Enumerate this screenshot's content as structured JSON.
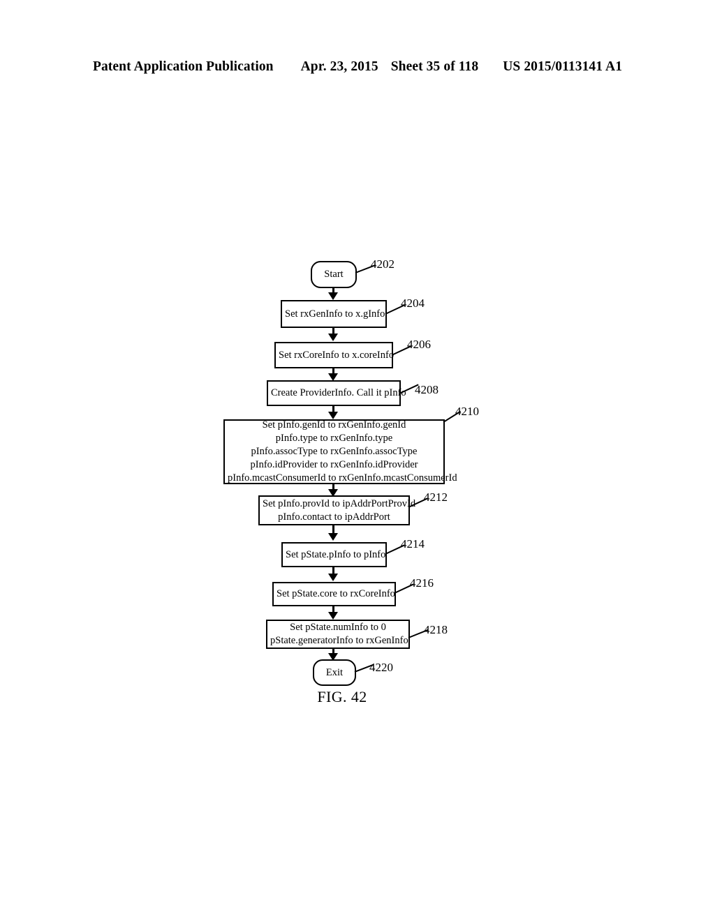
{
  "header": {
    "publication": "Patent Application Publication",
    "date": "Apr. 23, 2015",
    "sheet": "Sheet 35 of 118",
    "patent_number": "US 2015/0113141 A1"
  },
  "figure": {
    "caption": "FIG. 42",
    "nodes": [
      {
        "ref": "4202",
        "shape": "terminator",
        "lines": [
          "Start"
        ]
      },
      {
        "ref": "4204",
        "shape": "process",
        "lines": [
          "Set rxGenInfo to x.gInfo"
        ]
      },
      {
        "ref": "4206",
        "shape": "process",
        "lines": [
          "Set rxCoreInfo to x.coreInfo"
        ]
      },
      {
        "ref": "4208",
        "shape": "process",
        "lines": [
          "Create ProviderInfo. Call it pInfo"
        ]
      },
      {
        "ref": "4210",
        "shape": "process",
        "lines": [
          "Set pInfo.genId to rxGenInfo.genId",
          "pInfo.type to rxGenInfo.type",
          "pInfo.assocType to rxGenInfo.assocType",
          "pInfo.idProvider to rxGenInfo.idProvider",
          "pInfo.mcastConsumerId to rxGenInfo.mcastConsumerId"
        ]
      },
      {
        "ref": "4212",
        "shape": "process",
        "lines": [
          "Set pInfo.provId to ipAddrPortProvId",
          "pInfo.contact to ipAddrPort"
        ]
      },
      {
        "ref": "4214",
        "shape": "process",
        "lines": [
          "Set pState.pInfo to pInfo"
        ]
      },
      {
        "ref": "4216",
        "shape": "process",
        "lines": [
          "Set pState.core to rxCoreInfo"
        ]
      },
      {
        "ref": "4218",
        "shape": "process",
        "lines": [
          "Set pState.numInfo to 0",
          "pState.generatorInfo to rxGenInfo"
        ]
      },
      {
        "ref": "4220",
        "shape": "terminator",
        "lines": [
          "Exit"
        ]
      }
    ]
  }
}
